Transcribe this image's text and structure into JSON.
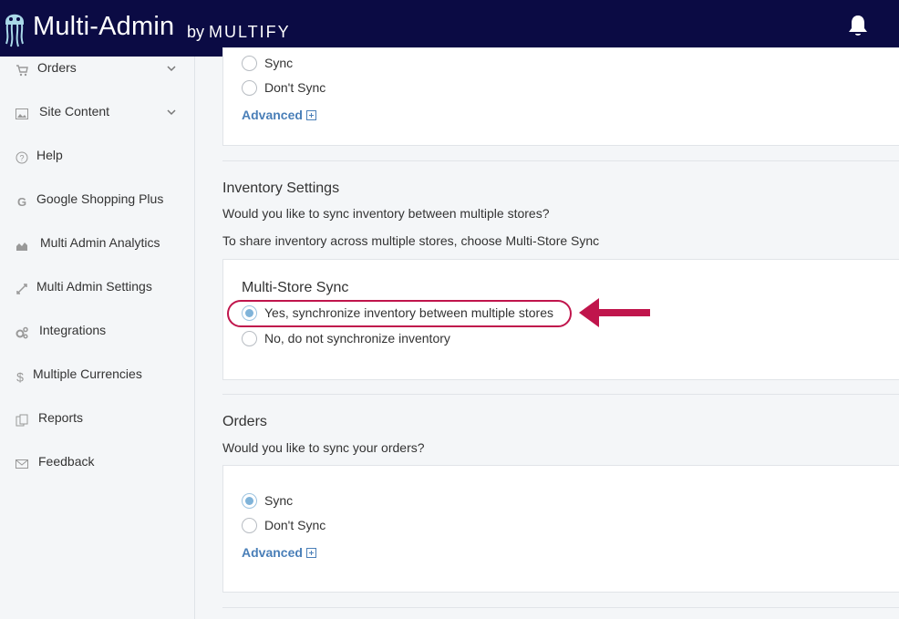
{
  "header": {
    "title": "Multi-Admin",
    "by": "by",
    "brand": "MULTIFY",
    "logo_icon": "jellyfish-logo-icon",
    "notification_icon": "bell-icon"
  },
  "sidebar": {
    "items": [
      {
        "label": "Orders",
        "icon": "cart-icon",
        "has_chevron": true
      },
      {
        "label": "Site Content",
        "icon": "image-icon",
        "has_chevron": true
      },
      {
        "label": "Help",
        "icon": "help-circle-icon"
      },
      {
        "label": "Google Shopping Plus",
        "icon": "google-icon"
      },
      {
        "label": "Multi Admin Analytics",
        "icon": "area-chart-icon"
      },
      {
        "label": "Multi Admin Settings",
        "icon": "sync-arrows-icon"
      },
      {
        "label": "Integrations",
        "icon": "cogs-icon"
      },
      {
        "label": "Multiple Currencies",
        "icon": "dollar-icon"
      },
      {
        "label": "Reports",
        "icon": "copy-icon"
      },
      {
        "label": "Feedback",
        "icon": "envelope-icon"
      }
    ]
  },
  "top_card": {
    "options": [
      {
        "label": "Sync",
        "checked": false
      },
      {
        "label": "Don't Sync",
        "checked": false
      }
    ],
    "advanced_label": "Advanced"
  },
  "inventory": {
    "title": "Inventory Settings",
    "question": "Would you like to sync inventory between multiple stores?",
    "hint": "To share inventory across multiple stores, choose Multi-Store Sync",
    "card_title": "Multi-Store Sync",
    "options": [
      {
        "label": "Yes, synchronize inventory between multiple stores",
        "checked": true
      },
      {
        "label": "No, do not synchronize inventory",
        "checked": false
      }
    ]
  },
  "orders": {
    "title": "Orders",
    "question": "Would you like to sync your orders?",
    "options": [
      {
        "label": "Sync",
        "checked": true
      },
      {
        "label": "Don't Sync",
        "checked": false
      }
    ],
    "advanced_label": "Advanced"
  },
  "colors": {
    "topbar": "#0b0b44",
    "annotation": "#c0154c",
    "link": "#4a7fb8",
    "radio_checked": "#7fb3d9"
  }
}
